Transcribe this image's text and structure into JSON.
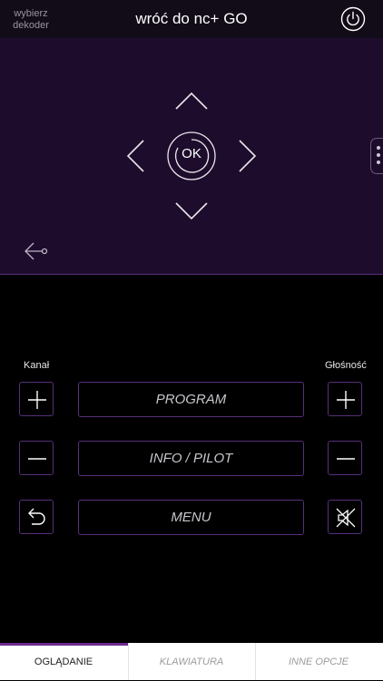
{
  "header": {
    "select_decoder_line1": "wybierz",
    "select_decoder_line2": "dekoder",
    "title": "wróć do nc+ GO",
    "power_icon": "power-icon"
  },
  "dpad": {
    "ok_label": "OK",
    "icons": [
      "chevron-up-icon",
      "chevron-down-icon",
      "chevron-left-icon",
      "chevron-right-icon",
      "back-arrow-icon",
      "more-dots-icon"
    ]
  },
  "controls": {
    "channel_label": "Kanał",
    "volume_label": "Głośność",
    "program_label": "PROGRAM",
    "info_label": "INFO / PILOT",
    "menu_label": "MENU"
  },
  "tabs": [
    {
      "label": "OGLĄDANIE",
      "active": true
    },
    {
      "label": "KLAWIATURA",
      "active": false
    },
    {
      "label": "INNE OPCJE",
      "active": false
    }
  ],
  "colors": {
    "accent": "#6d2c90",
    "dpad_bg": "#1e0c2d",
    "button_border": "#56307a"
  }
}
